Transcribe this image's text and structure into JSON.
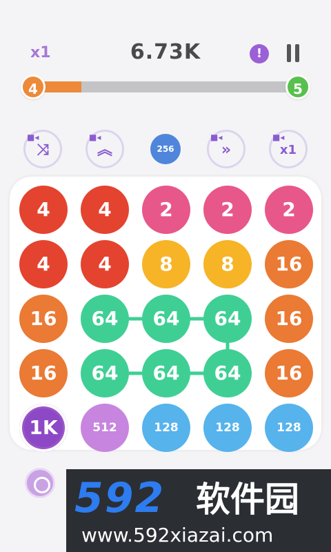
{
  "header": {
    "multiplier": "x1",
    "score": "6.73K",
    "info_label": "!"
  },
  "level": {
    "current": "4",
    "next": "5",
    "progress_fraction": 0.18,
    "fill_color": "#ec8a3a",
    "next_color": "#58c04e"
  },
  "powerups": [
    {
      "name": "shuffle",
      "glyph": "⤨"
    },
    {
      "name": "upgrade",
      "glyph": "︽"
    },
    {
      "name": "fast-forward",
      "glyph": "»"
    },
    {
      "name": "multiplier",
      "glyph": "x1"
    }
  ],
  "next_tile": "256",
  "board": {
    "columns": 5,
    "rows": [
      [
        {
          "v": "4",
          "c": "#e4432f"
        },
        {
          "v": "4",
          "c": "#e4432f"
        },
        {
          "v": "2",
          "c": "#e8578a"
        },
        {
          "v": "2",
          "c": "#e8578a"
        },
        {
          "v": "2",
          "c": "#e8578a"
        }
      ],
      [
        {
          "v": "4",
          "c": "#e4432f"
        },
        {
          "v": "4",
          "c": "#e4432f"
        },
        {
          "v": "8",
          "c": "#f6b426"
        },
        {
          "v": "8",
          "c": "#f6b426"
        },
        {
          "v": "16",
          "c": "#ea7a34"
        }
      ],
      [
        {
          "v": "16",
          "c": "#ea7a34"
        },
        {
          "v": "64",
          "c": "#3fcf94"
        },
        {
          "v": "64",
          "c": "#3fcf94"
        },
        {
          "v": "64",
          "c": "#3fcf94"
        },
        {
          "v": "16",
          "c": "#ea7a34"
        }
      ],
      [
        {
          "v": "16",
          "c": "#ea7a34"
        },
        {
          "v": "64",
          "c": "#3fcf94"
        },
        {
          "v": "64",
          "c": "#3fcf94"
        },
        {
          "v": "64",
          "c": "#3fcf94"
        },
        {
          "v": "16",
          "c": "#ea7a34"
        }
      ],
      [
        {
          "v": "1K",
          "c": "#8d49c5",
          "ring": true
        },
        {
          "v": "512",
          "c": "#c785df"
        },
        {
          "v": "128",
          "c": "#56b3ec"
        },
        {
          "v": "128",
          "c": "#56b3ec"
        },
        {
          "v": "128",
          "c": "#56b3ec"
        }
      ]
    ],
    "chain": [
      [
        2,
        1
      ],
      [
        2,
        2
      ],
      [
        2,
        3
      ],
      [
        3,
        3
      ],
      [
        3,
        2
      ],
      [
        3,
        1
      ]
    ],
    "chain_color": "#3fcf94"
  },
  "watermark": {
    "logo": "592",
    "name": "软件园",
    "url": "www.592xiazai.com"
  }
}
